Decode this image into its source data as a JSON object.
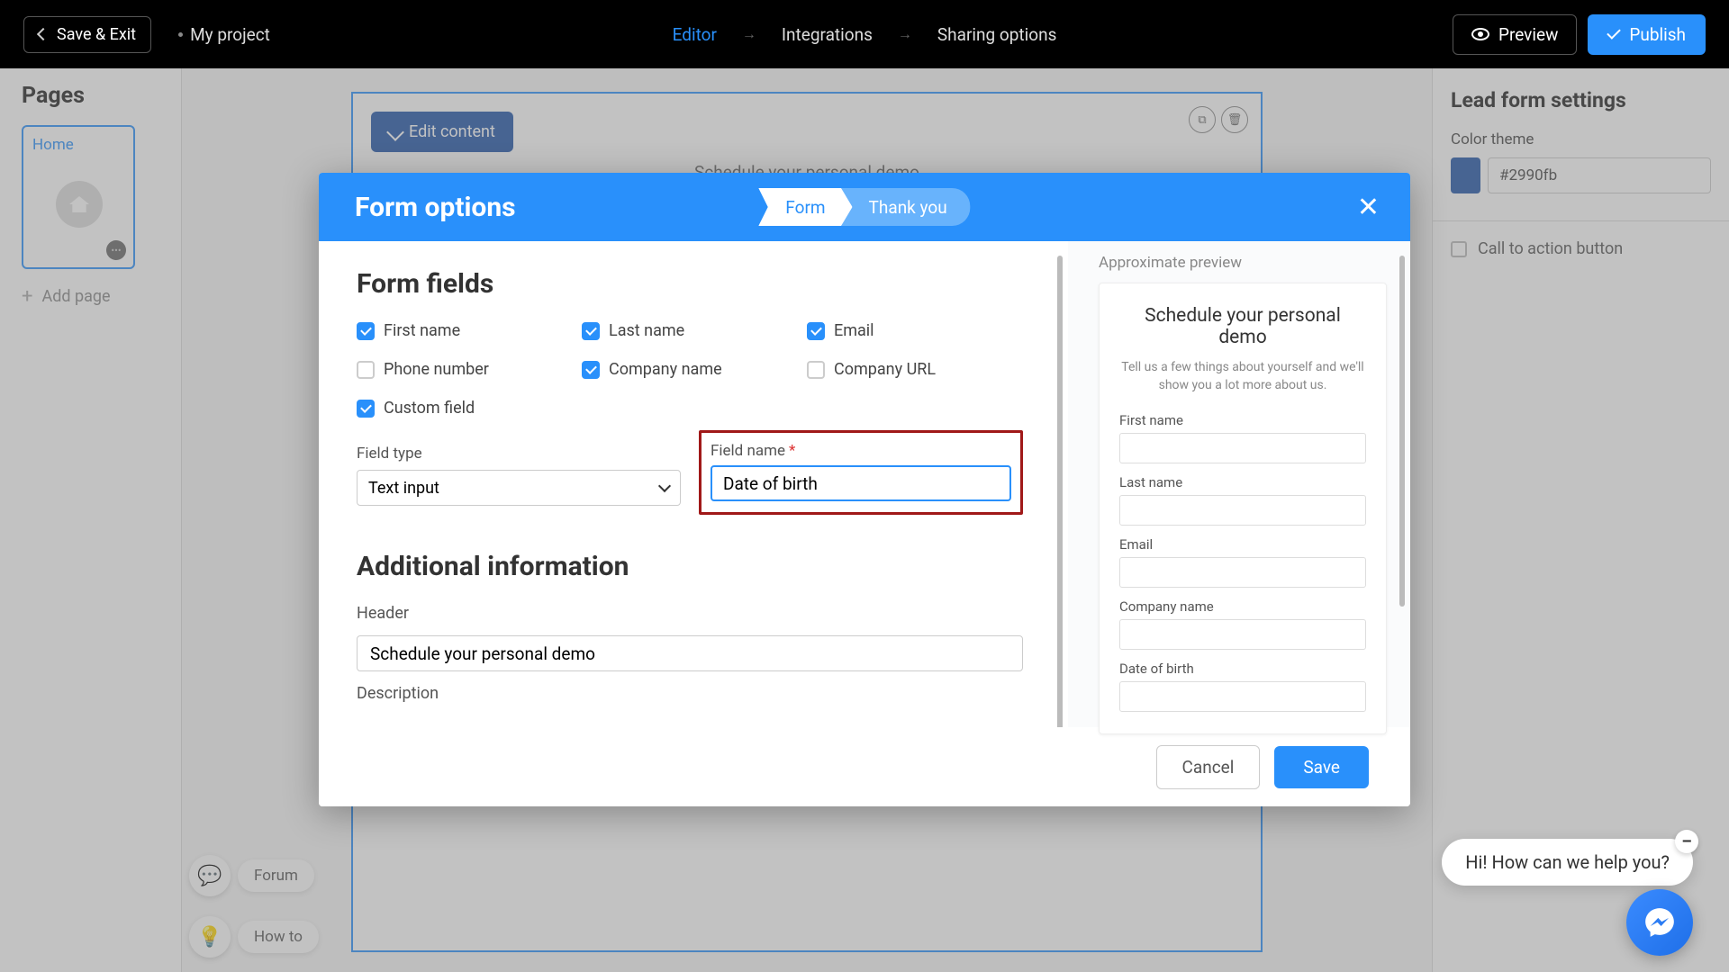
{
  "topbar": {
    "save_exit": "Save & Exit",
    "project": "My project",
    "nav": {
      "editor": "Editor",
      "integrations": "Integrations",
      "sharing": "Sharing options"
    },
    "preview": "Preview",
    "publish": "Publish"
  },
  "left": {
    "title": "Pages",
    "page1": "Home",
    "add": "Add page"
  },
  "canvas": {
    "edit": "Edit content",
    "heading": "Schedule your personal demo"
  },
  "right": {
    "title": "Lead form settings",
    "color_label": "Color theme",
    "color_value": "#2990fb",
    "cta": "Call to action button"
  },
  "modal": {
    "title": "Form options",
    "tab_form": "Form",
    "tab_thank": "Thank you",
    "section_fields": "Form fields",
    "field": {
      "first": "First name",
      "last": "Last name",
      "email": "Email",
      "phone": "Phone number",
      "company": "Company name",
      "url": "Company URL",
      "custom": "Custom field"
    },
    "field_type_label": "Field type",
    "field_type_value": "Text input",
    "field_name_label": "Field name",
    "field_name_value": "Date of birth",
    "section_additional": "Additional information",
    "header_label": "Header",
    "header_value": "Schedule your personal demo",
    "desc_label": "Description",
    "cancel": "Cancel",
    "save": "Save",
    "preview_label": "Approximate preview",
    "preview": {
      "title": "Schedule your personal demo",
      "desc": "Tell us a few things about yourself and we'll show you a lot more about us.",
      "f1": "First name",
      "f2": "Last name",
      "f3": "Email",
      "f4": "Company name",
      "f5": "Date of birth"
    }
  },
  "help": {
    "forum": "Forum",
    "howto": "How to",
    "chat": "Hi! How can we help you?"
  }
}
